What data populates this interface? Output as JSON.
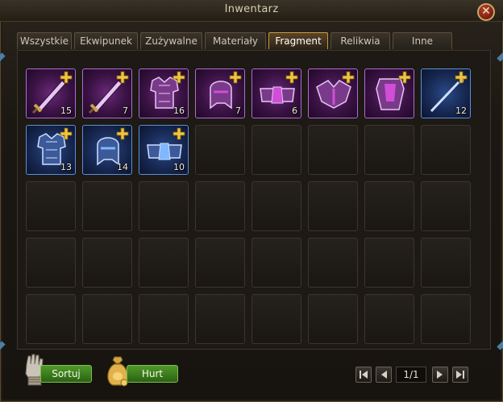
{
  "window": {
    "title": "Inwentarz"
  },
  "tabs": [
    {
      "label": "Wszystkie",
      "active": false
    },
    {
      "label": "Ekwipunek",
      "active": false
    },
    {
      "label": "Zużywalne",
      "active": false
    },
    {
      "label": "Materiały",
      "active": false
    },
    {
      "label": "Fragment",
      "active": true
    },
    {
      "label": "Relikwia",
      "active": false
    },
    {
      "label": "Inne",
      "active": false
    }
  ],
  "inventory": {
    "columns": 8,
    "rows": 5,
    "items": [
      {
        "icon": "purple-sword-icon",
        "rarity": "purple",
        "count": "15"
      },
      {
        "icon": "purple-sword-icon",
        "rarity": "purple",
        "count": "7"
      },
      {
        "icon": "purple-armor-icon",
        "rarity": "purple",
        "count": "16"
      },
      {
        "icon": "purple-helmet-icon",
        "rarity": "purple",
        "count": "7"
      },
      {
        "icon": "purple-belt-icon",
        "rarity": "purple",
        "count": "6"
      },
      {
        "icon": "purple-pauldron-icon",
        "rarity": "purple",
        "count": ""
      },
      {
        "icon": "purple-chest-icon",
        "rarity": "purple",
        "count": ""
      },
      {
        "icon": "blue-spear-icon",
        "rarity": "blue",
        "count": "12"
      },
      {
        "icon": "blue-armor-icon",
        "rarity": "blue",
        "count": "13"
      },
      {
        "icon": "blue-helmet-icon",
        "rarity": "blue",
        "count": "14"
      },
      {
        "icon": "blue-belt-icon",
        "rarity": "blue",
        "count": "10"
      }
    ]
  },
  "buttons": {
    "sort_label": "Sortuj",
    "bulk_label": "Hurt"
  },
  "pagination": {
    "page_text": "1/1"
  },
  "colors": {
    "accent_gold": "#c79a45",
    "green_button": "#4f9a2a",
    "purple_rarity": "#b46ad6",
    "blue_rarity": "#5c8fd8"
  }
}
